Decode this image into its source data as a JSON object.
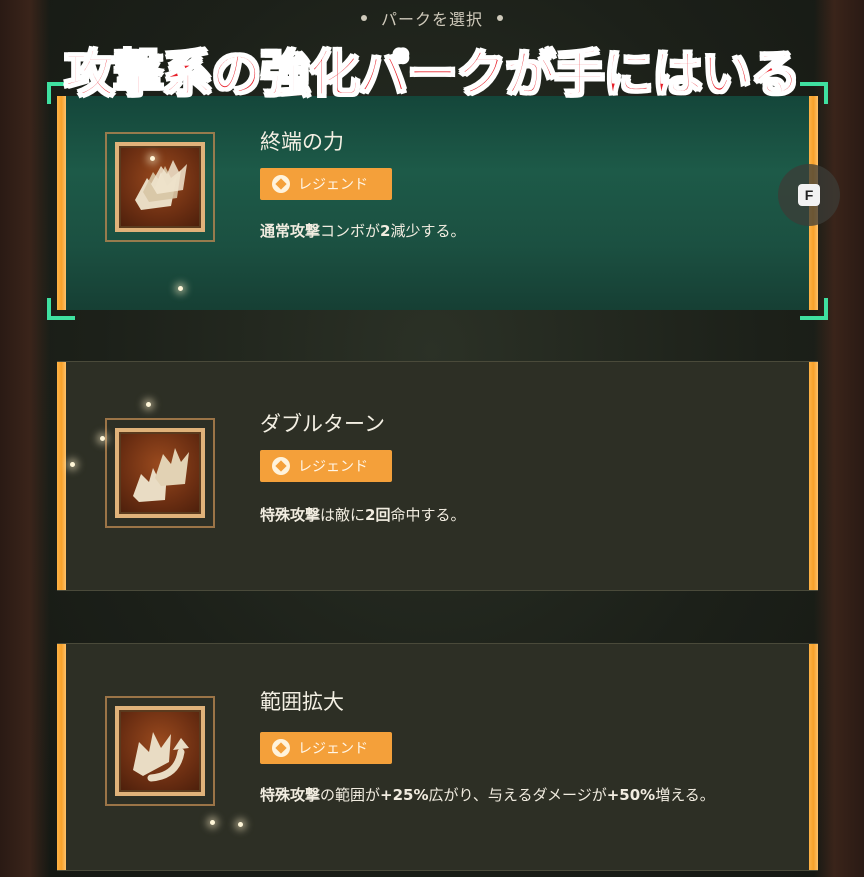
{
  "header": {
    "title": "パークを選択"
  },
  "overlay_caption": "攻撃系の強化パークが手にはいる",
  "hotkey": {
    "key": "F"
  },
  "perks": [
    {
      "title": "終端の力",
      "rarity": "レジェンド",
      "desc": [
        {
          "text": "通常攻撃",
          "bold": true
        },
        {
          "text": "コンボが",
          "bold": false
        },
        {
          "text": "2",
          "bold": true
        },
        {
          "text": "減少する。",
          "bold": false
        }
      ],
      "selected": true,
      "icon": "triple-claw-icon"
    },
    {
      "title": "ダブルターン",
      "rarity": "レジェンド",
      "desc": [
        {
          "text": "特殊攻撃",
          "bold": true
        },
        {
          "text": "は敵に",
          "bold": false
        },
        {
          "text": "2回",
          "bold": true
        },
        {
          "text": "命中する。",
          "bold": false
        }
      ],
      "selected": false,
      "icon": "double-claw-icon"
    },
    {
      "title": "範囲拡大",
      "rarity": "レジェンド",
      "desc": [
        {
          "text": "特殊攻撃",
          "bold": true
        },
        {
          "text": "の範囲が",
          "bold": false
        },
        {
          "text": "+25%",
          "bold": true
        },
        {
          "text": "広がり、与えるダメージが",
          "bold": false
        },
        {
          "text": "+50%",
          "bold": true
        },
        {
          "text": "増える。",
          "bold": false
        }
      ],
      "selected": false,
      "icon": "claw-arrow-icon"
    }
  ],
  "colors": {
    "accent_orange": "#f4a03a",
    "selected_teal": "#1d5a48",
    "corner_green": "#3fe0a0",
    "caption_red": "#e8202a"
  }
}
